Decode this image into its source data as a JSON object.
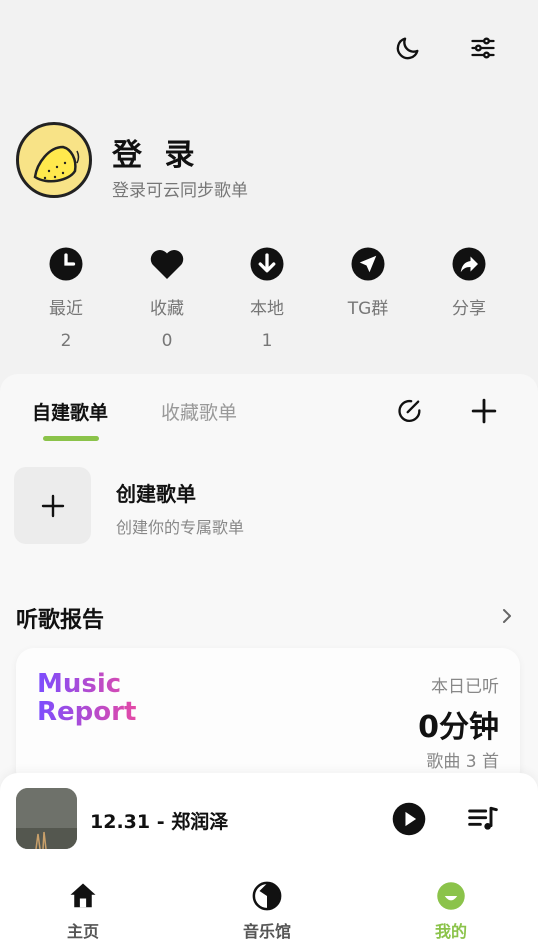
{
  "header": {
    "icons": [
      "moon-icon",
      "sliders-icon"
    ]
  },
  "user": {
    "name": "登 录",
    "subtitle": "登录可云同步歌单"
  },
  "quick_actions": [
    {
      "icon": "clock-icon",
      "label": "最近",
      "count": "2"
    },
    {
      "icon": "heart-icon",
      "label": "收藏",
      "count": "0"
    },
    {
      "icon": "download-icon",
      "label": "本地",
      "count": "1"
    },
    {
      "icon": "telegram-icon",
      "label": "TG群",
      "count": ""
    },
    {
      "icon": "share-icon",
      "label": "分享",
      "count": ""
    }
  ],
  "playlist_tabs": {
    "active": "自建歌单",
    "inactive": "收藏歌单"
  },
  "create_playlist": {
    "title": "创建歌单",
    "subtitle": "创建你的专属歌单"
  },
  "report_section": {
    "title": "听歌报告",
    "logo_line1": "Music",
    "logo_line2": "Report",
    "label": "本日已听",
    "value": "0分钟",
    "songs": "歌曲 3 首"
  },
  "player": {
    "track": "12.31 - 郑润泽"
  },
  "bottom_nav": [
    {
      "label": "主页",
      "icon": "home-icon"
    },
    {
      "label": "音乐馆",
      "icon": "music-hall-icon"
    },
    {
      "label": "我的",
      "icon": "profile-icon",
      "active": true
    }
  ],
  "colors": {
    "accent": "#8bc34a",
    "logo_start": "#7b4dff",
    "logo_end": "#e44aa6"
  }
}
